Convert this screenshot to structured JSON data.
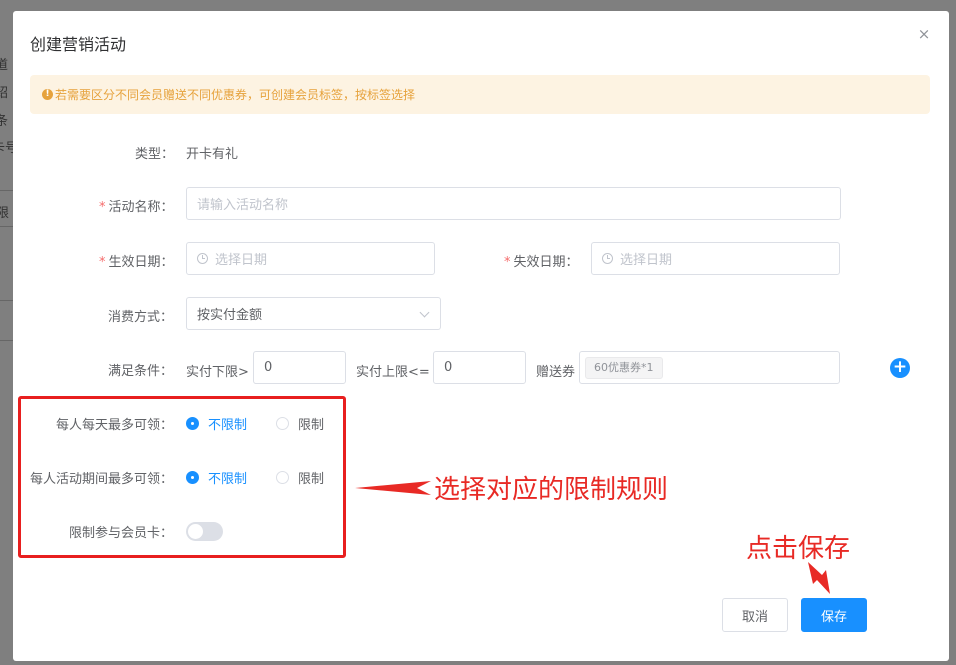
{
  "background": {
    "fragments": [
      "道",
      "绍",
      "条",
      "卡号",
      "限"
    ]
  },
  "dialog": {
    "title": "创建营销活动",
    "close_symbol": "×"
  },
  "alert": {
    "icon_symbol": "!",
    "text": "若需要区分不同会员赠送不同优惠券，可创建会员标签，按标签选择"
  },
  "form": {
    "type": {
      "label": "类型：",
      "value": "开卡有礼"
    },
    "activity_name": {
      "required_mark": "*",
      "label": "活动名称：",
      "placeholder": "请输入活动名称"
    },
    "effective_date": {
      "required_mark": "*",
      "label": "生效日期：",
      "placeholder": "选择日期"
    },
    "expire_date": {
      "required_mark": "*",
      "label": "失效日期：",
      "placeholder": "选择日期"
    },
    "consume_method": {
      "label": "消费方式：",
      "value": "按实付金额"
    },
    "condition": {
      "label": "满足条件：",
      "lower_label": "实付下限>",
      "lower_value": "0",
      "upper_label": "实付上限<=",
      "upper_value": "0",
      "gift_label": "赠送券",
      "gift_tag": "60优惠券*1",
      "add_symbol": "+"
    },
    "daily_limit": {
      "label": "每人每天最多可领：",
      "options": [
        "不限制",
        "限制"
      ],
      "selected": "不限制"
    },
    "period_limit": {
      "label": "每人活动期间最多可领：",
      "options": [
        "不限制",
        "限制"
      ],
      "selected": "不限制"
    },
    "member_card": {
      "label": "限制参与会员卡：",
      "enabled": false
    }
  },
  "annotations": {
    "limit_rule": "选择对应的限制规则",
    "click_save": "点击保存",
    "color": "#e82a25"
  },
  "footer": {
    "cancel_label": "取消",
    "save_label": "保存"
  },
  "colors": {
    "primary": "#1890ff",
    "warning": "#e6a23c",
    "danger": "#f56c6c"
  }
}
